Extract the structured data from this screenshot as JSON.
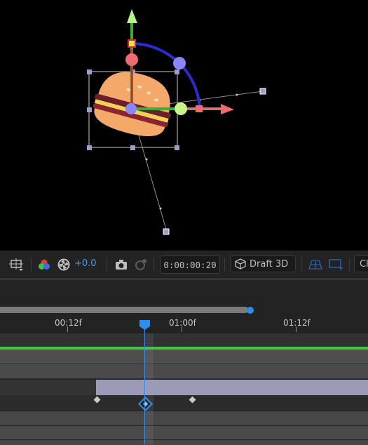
{
  "toolbar": {
    "exposure": "+0.0",
    "timecode": "0:00:00:20",
    "renderer_label": "Draft 3D",
    "truncated_label": "Cl",
    "accent_color": "#2d8cf0"
  },
  "ruler": {
    "labels": [
      "00:12f",
      "01:00f",
      "01:12f"
    ]
  },
  "viewport": {
    "layer_icon": "hamburger-icon",
    "gizmo_colors": {
      "x_axis": "#ef6b73",
      "y_axis": "#a6e37a",
      "z_axis": "#3b2fd0",
      "track_green": "#3bb02f"
    }
  }
}
